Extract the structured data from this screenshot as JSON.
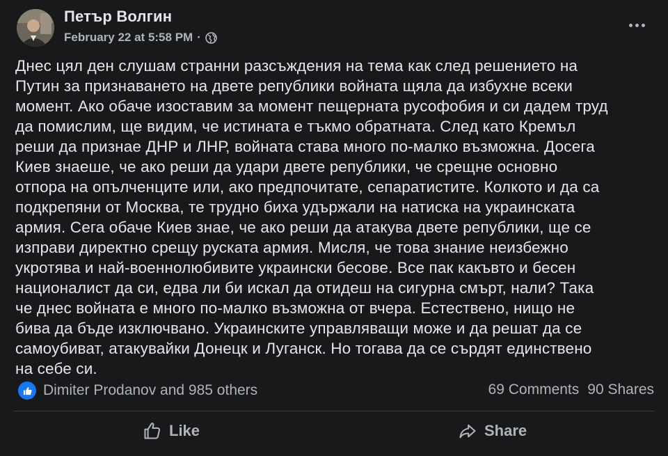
{
  "author": {
    "name": "Петър Волгин"
  },
  "post": {
    "timestamp": "February 22 at 5:58 PM",
    "separator": "·",
    "privacy_icon": "globe-icon",
    "body": "Днес цял ден слушам странни разсъждения на тема как след решението на\nПутин за признаването на двете републики войната щяла да избухне всеки\nмомент. Ако обаче изоставим за момент пещерната русофобия и си дадем труд\nда помислим, ще видим, че истината е тъкмо обратната. След като Кремъл\nреши да признае ДНР и ЛНР, войната става много по-малко възможна. Досега\nКиев знаеше, че ако реши да удари двете републики, че срещне основно\nотпора на опълченците или, ако предпочитате, сепаратистите. Колкото и да са\nподкрепяни от Москва, те трудно биха удържали на натиска на украинската\nармия. Сега обаче Киев знае, че ако реши да атакува двете републики, ще се\nизправи директно срещу руската армия. Мисля, че това знание неизбежно\nукротява и най-военнолюбивите украински бесове. Все пак какъвто и бесен\nнационалист да си, едва ли би искал да отидеш на сигурна смърт, нали? Така\nче днес войната е много по-малко възможна от вчера. Естествено, нищо не\nбива да бъде изключвано. Украинските управляващи може и да решат да се\nсамоубиват, атакувайки Донецк и Луганск. Но тогава да се сърдят единствено\nна себе си."
  },
  "reactions": {
    "text": "Dimiter Prodanov and 985 others",
    "icon": "like-reaction-icon"
  },
  "stats": {
    "comments": "69 Comments",
    "shares": "90 Shares"
  },
  "actions": {
    "like": "Like",
    "share": "Share"
  },
  "colors": {
    "background": "#18191a",
    "text": "#e4e6eb",
    "muted": "#b0b3b8",
    "accent": "#1877f2"
  }
}
